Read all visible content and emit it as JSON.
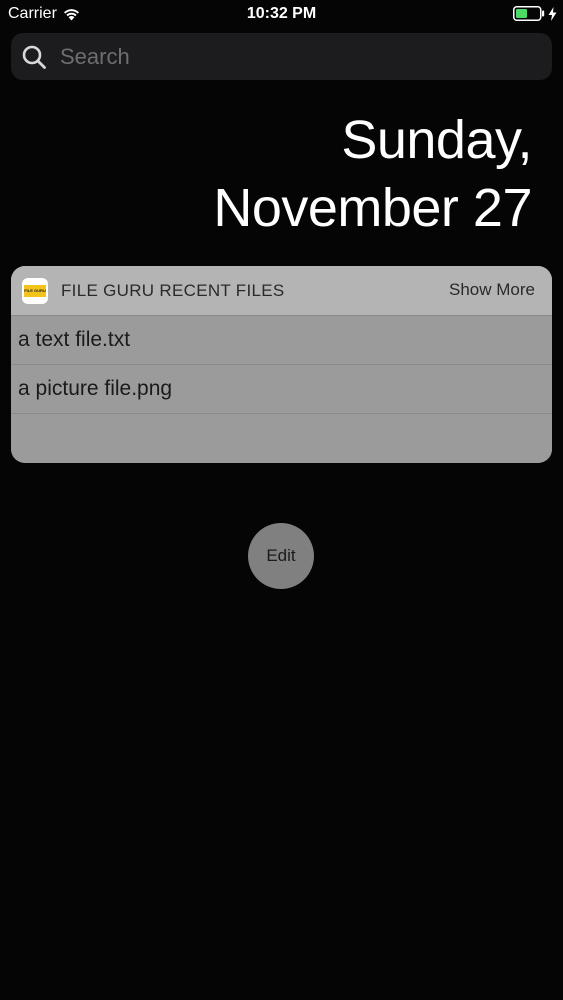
{
  "status_bar": {
    "carrier": "Carrier",
    "time": "10:32 PM",
    "wifi_icon": "wifi-icon",
    "battery_icon": "battery-charging-icon",
    "battery_color": "#4cd964"
  },
  "search": {
    "placeholder": "Search",
    "icon": "search-icon"
  },
  "date": {
    "weekday": "Sunday,",
    "month_day": "November 27"
  },
  "widget": {
    "app_icon_text": "FILE GURU",
    "title": "FILE GURU RECENT FILES",
    "show_more_label": "Show More",
    "files": [
      {
        "name": "a text file.txt"
      },
      {
        "name": "a picture file.png"
      }
    ]
  },
  "edit_button": {
    "label": "Edit"
  },
  "colors": {
    "background": "#050505",
    "widget_header": "#b4b4b4",
    "widget_body": "#9b9b9b",
    "app_icon_accent": "#f2c31a"
  }
}
